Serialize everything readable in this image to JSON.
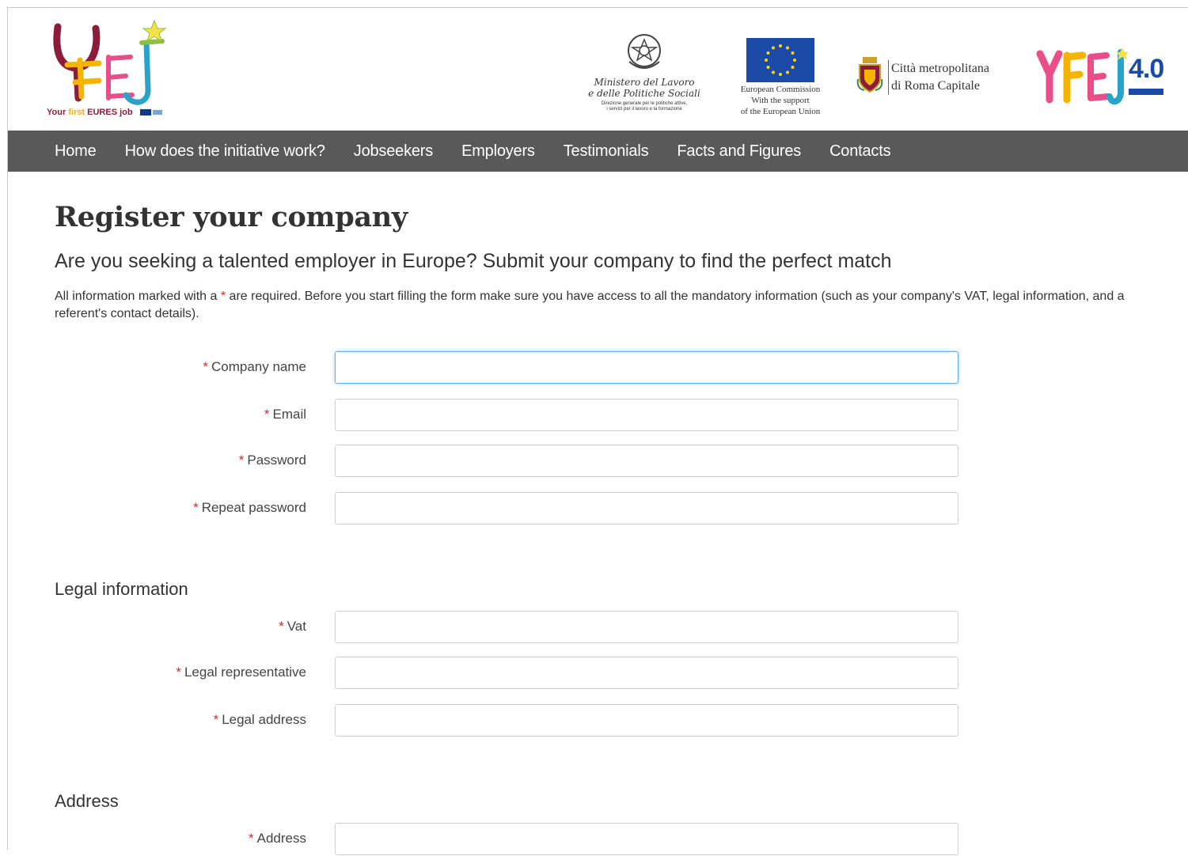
{
  "header": {
    "logo_tagline": {
      "part1": "Your",
      "part2": "first",
      "part3": "EURES job"
    },
    "ministero": {
      "line1": "Ministero del Lavoro",
      "line2": "e delle Politiche Sociali",
      "small1": "Direzione generale per le politiche attive,",
      "small2": "i servizi per il lavoro e la formazione"
    },
    "ec": {
      "line1": "European Commission",
      "line2": "With the support",
      "line3": "of the European Union"
    },
    "roma": {
      "line1": "Città metropolitana",
      "line2": "di Roma Capitale"
    },
    "yfej40_version": "4.0"
  },
  "nav": {
    "items": [
      {
        "label": "Home"
      },
      {
        "label": "How does the initiative work?"
      },
      {
        "label": "Jobseekers"
      },
      {
        "label": "Employers"
      },
      {
        "label": "Testimonials"
      },
      {
        "label": "Facts and Figures"
      },
      {
        "label": "Contacts"
      }
    ]
  },
  "page": {
    "title": "Register your company",
    "subtitle": "Are you seeking a talented employer in Europe? Submit your company to find the perfect match",
    "note_before": "All information marked with a ",
    "note_star": "*",
    "note_after": " are required. Before you start filling the form make sure you have access to all the mandatory information (such as your company's VAT, legal information, and a referent's contact details)."
  },
  "form": {
    "required_marker": "*",
    "account": [
      {
        "label": "Company name",
        "value": ""
      },
      {
        "label": "Email",
        "value": ""
      },
      {
        "label": "Password",
        "value": ""
      },
      {
        "label": "Repeat password",
        "value": ""
      }
    ],
    "legal_heading": "Legal information",
    "legal": [
      {
        "label": "Vat",
        "value": ""
      },
      {
        "label": "Legal representative",
        "value": ""
      },
      {
        "label": "Legal address",
        "value": ""
      }
    ],
    "address_heading": "Address",
    "address": [
      {
        "label": "Address",
        "value": ""
      }
    ]
  },
  "colors": {
    "nav_bg": "#595959",
    "required_star": "#c9302c",
    "focus_border": "#66afe9",
    "eu_blue": "#1c4aa8"
  }
}
